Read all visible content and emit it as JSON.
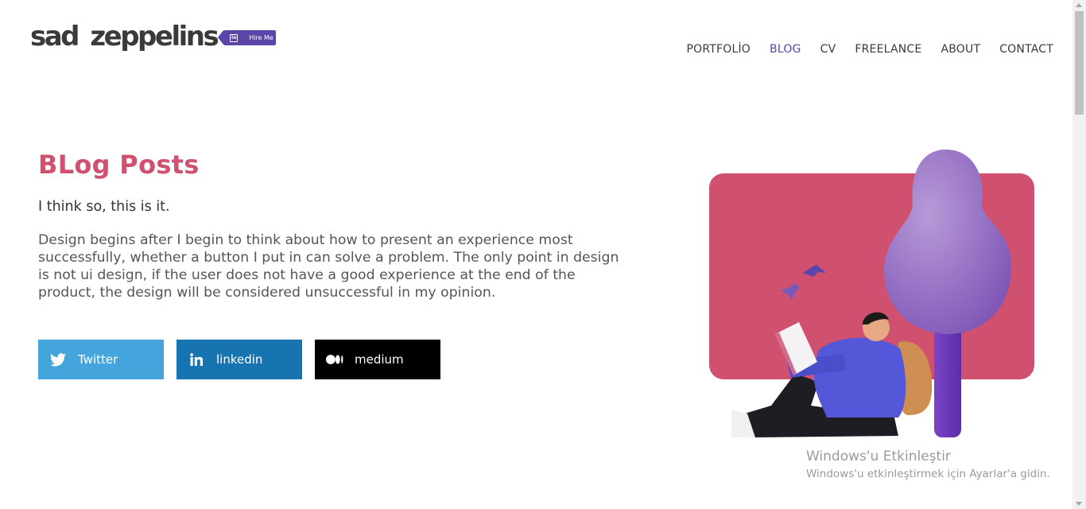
{
  "header": {
    "logo_text": "sad zeppelins",
    "hire_label": "Hire Me",
    "nav": [
      {
        "label": "PORTFOLİO",
        "active": false
      },
      {
        "label": "BLOG",
        "active": true
      },
      {
        "label": "CV",
        "active": false
      },
      {
        "label": "FREELANCE",
        "active": false
      },
      {
        "label": "ABOUT",
        "active": false
      },
      {
        "label": "CONTACT",
        "active": false
      }
    ]
  },
  "main": {
    "title": "BLog Posts",
    "subtitle": "I think so, this is it.",
    "description": "Design begins after I begin to think about how to present an experience most successfully, whether a button I put in can solve a problem. The only point in design is not ui design, if the user does not have a good experience at the end of the product, the design will be considered unsuccessful in my opinion.",
    "socials": [
      {
        "label": "Twitter",
        "icon": "twitter-icon",
        "color": "#44a4dc"
      },
      {
        "label": "linkedin",
        "icon": "linkedin-icon",
        "color": "#1774b0"
      },
      {
        "label": "medium",
        "icon": "medium-icon",
        "color": "#000000"
      }
    ]
  },
  "watermark": {
    "title": "Windows'u Etkinleştir",
    "subtitle": "Windows'u etkinleştirmek için Ayarlar'a gidin."
  },
  "colors": {
    "accent": "#5b45a8",
    "title": "#d0506f",
    "illustration_bg": "#d0506f"
  }
}
